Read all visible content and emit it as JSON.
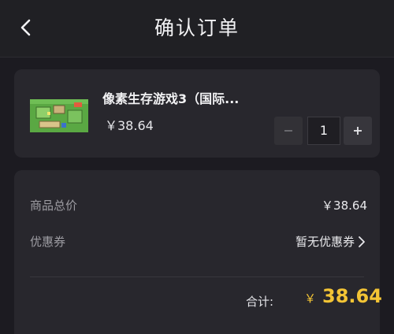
{
  "header": {
    "title": "确认订单",
    "back_icon": "chevron-left-icon"
  },
  "product": {
    "name": "像素生存游戏3（国际...",
    "price": "￥38.64",
    "quantity": "1",
    "thumbnail_icon": "game-cover-thumbnail",
    "minus_icon": "minus-icon",
    "plus_icon": "plus-icon"
  },
  "summary": {
    "total_label": "商品总价",
    "total_value": "￥38.64",
    "coupon_label": "优惠券",
    "coupon_value": "暂无优惠券",
    "coupon_icon": "chevron-right-icon",
    "sum_label": "合计:",
    "sum_currency": "￥",
    "sum_amount": "38.64"
  },
  "colors": {
    "background": "#1c1b21",
    "card": "#28272d",
    "accent_price": "#f3c435"
  }
}
